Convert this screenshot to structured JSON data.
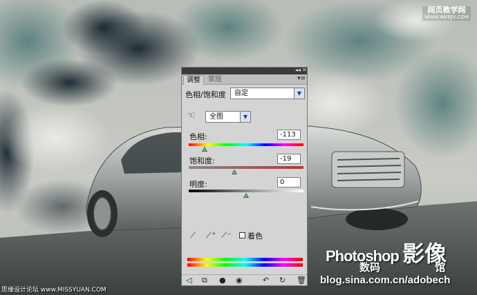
{
  "watermark_top": {
    "line1": "网页教学网",
    "line2": "WWW.WEBJX.COM"
  },
  "panel": {
    "tabs": [
      "调整",
      "蒙版"
    ],
    "preset_label": "色相/饱和度",
    "preset_value": "自定",
    "channel_value": "全图",
    "sliders": [
      {
        "label": "色相:",
        "value": "-113",
        "fraction": 0.14
      },
      {
        "label": "饱和度:",
        "value": "-19",
        "fraction": 0.4
      },
      {
        "label": "明度:",
        "value": "0",
        "fraction": 0.5
      }
    ],
    "colorize_label": "着色",
    "eyedroppers": [
      "eyedropper-icon",
      "eyedropper-plus-icon",
      "eyedropper-minus-icon"
    ],
    "footer_icons": [
      "back-arrow-icon",
      "clip-layer-icon",
      "visibility-toggle-icon",
      "eye-icon",
      "previous-state-icon",
      "reset-icon",
      "trash-icon"
    ]
  },
  "brand": {
    "line1_latin": "Photoshop",
    "line1_cjk": "影像",
    "line2_a": "数码",
    "line2_b": "馆",
    "blog": "blog.sina.com.cn/adobech"
  },
  "watermark_bottom": "思缘设计论坛 www.MISSYUAN.COM"
}
